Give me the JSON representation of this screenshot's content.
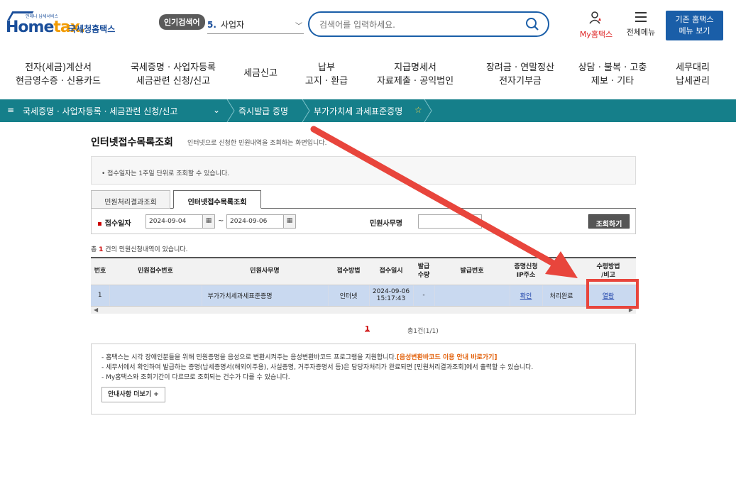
{
  "header": {
    "logo_tagline": "언제나 납세서비스",
    "logo_home": "Home",
    "logo_tax": "tax.",
    "logo_sub": "국세청홈택스",
    "popular_badge": "인기검색어",
    "popular_num": "5.",
    "popular_term": "사업자",
    "search_placeholder": "검색어를 입력하세요.",
    "my_hometax": "My홈택스",
    "all_menu": "전체메뉴",
    "old_site_line1": "기존 홈택스",
    "old_site_line2": "메뉴 보기"
  },
  "mainnav": [
    {
      "l1": "전자(세금)계산서",
      "l2": "현금영수증 · 신용카드"
    },
    {
      "l1": "국세증명 · 사업자등록",
      "l2": "세금관련 신청/신고"
    },
    {
      "l1": "세금신고",
      "l2": ""
    },
    {
      "l1": "납부",
      "l2": "고지 · 환급"
    },
    {
      "l1": "지급명세서",
      "l2": "자료제출 · 공익법인"
    },
    {
      "l1": "장려금 · 연말정산",
      "l2": "전자기부금"
    },
    {
      "l1": "상담 · 불복 · 고충",
      "l2": "제보 · 기타"
    },
    {
      "l1": "세무대리",
      "l2": "납세관리"
    }
  ],
  "breadcrumb": {
    "menu_icon": "≡",
    "c1": "국세증명 · 사업자등록 · 세금관련 신청/신고",
    "c2": "즉시발급 증명",
    "c3": "부가가치세 과세표준증명",
    "star": "☆"
  },
  "page": {
    "title": "인터넷접수목록조회",
    "desc": "인터넷으로 신청한 민원내역을 조회하는 화면입니다.",
    "notice1": "• 접수일자는 1주일 단위로 조회할 수 있습니다.",
    "tabs": [
      "민원처리결과조회",
      "인터넷접수목록조회"
    ],
    "filter": {
      "date_label": "접수일자",
      "date_from": "2024-09-04",
      "date_to": "2024-09-06",
      "tilde": "~",
      "cal_icon": "▦",
      "type_label": "민원사무명",
      "search_btn": "조회하기"
    },
    "count_pre": "총 ",
    "count_num": "1",
    "count_post": " 건의 민원신청내역이 있습니다.",
    "table": {
      "headers": [
        "번호",
        "민원접수번호",
        "민원사무명",
        "접수방법",
        "접수일시",
        "발급\n수량",
        "발급번호",
        "증명신청\nIP주소",
        "상태",
        "수령방법\n/비고"
      ],
      "rows": [
        [
          "1",
          "",
          "부가가치세과세표준증명",
          "인터넷",
          "2024-09-06\n15:17:43",
          "-",
          "",
          "확인",
          "처리완료",
          "열람"
        ]
      ]
    },
    "pager_current": "1",
    "pager_info": "총1건(1/1)",
    "notice2": {
      "l1_pre": "- 홈택스는 시각 장애인분들을 위해 민원증명을 음성으로 변환시켜주는 음성변환바코드 프로그램을 지원합니다.",
      "l1_hl": "[음성변환바코드 이용 안내 바로가기]",
      "l2": "- 세무서에서 확인하여 발급하는 증명(납세증명서(해외이주용), 사실증명, 거주자증명서 등)은 담당자처리가 완료되면 [민원처리결과조회]에서 출력할 수 있습니다.",
      "l3": "- My홈택스와 조회기간이 다르므로 조회되는 건수가 다를 수 있습니다.",
      "more_btn": "안내사항 더보기 +"
    }
  },
  "annotation_color": "#e8453c",
  "brand_color": "#1a5ea8",
  "crumb_bg": "#157f8a"
}
